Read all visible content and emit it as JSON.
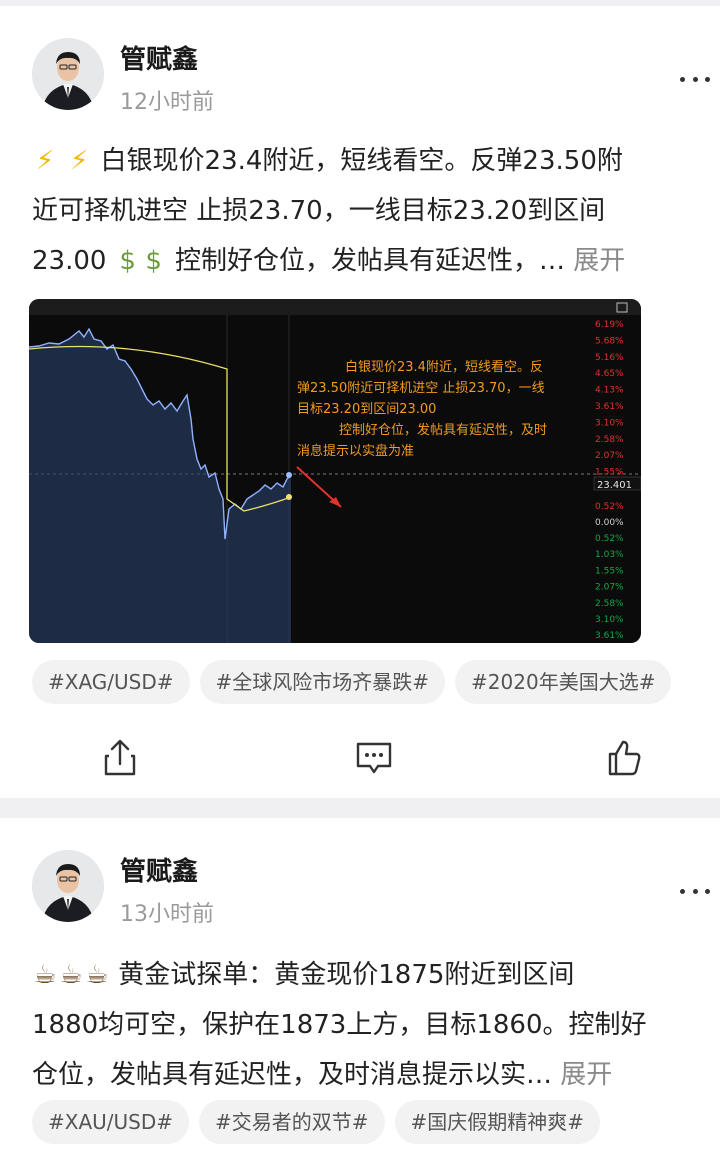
{
  "posts": [
    {
      "author": "管赋鑫",
      "time": "12小时前",
      "lines": [
        "白银现价23.4附近，短线看空。反弹23.50附",
        "近可择机进空 止损23.70，一线目标23.20到区间",
        "23.00",
        "控制好仓位，发帖具有延迟性，…"
      ],
      "expand_label": "展开",
      "lead_icons": [
        "lightning-icon",
        "lightning-icon"
      ],
      "mid_icons": [
        "money-bag-icon",
        "money-bag-icon"
      ],
      "tags": [
        "#XAG/USD#",
        "#全球风险市场齐暴跌#",
        "#2020年美国大选#"
      ],
      "chart": {
        "current_price": "23.401",
        "annotation": [
          "白银现价23.4附近，短线看空。反",
          "弹23.50附近可择机进空 止损23.70，一线",
          "目标23.20到区间23.00",
          "控制好仓位，发帖具有延迟性，及时",
          "消息提示以实盘为准"
        ],
        "right_axis_up": [
          "6.19%",
          "5.68%",
          "5.16%",
          "4.65%",
          "4.13%",
          "3.61%",
          "3.10%",
          "2.58%",
          "2.07%",
          "1.55%"
        ],
        "right_axis_mid": [
          "0.52%",
          "0.00%"
        ],
        "right_axis_down": [
          "0.52%",
          "1.03%",
          "1.55%",
          "2.07%",
          "2.58%",
          "3.10%",
          "3.61%"
        ]
      }
    },
    {
      "author": "管赋鑫",
      "time": "13小时前",
      "lines": [
        "黄金试探单：黄金现价1875附近到区间",
        "1880均可空，保护在1873上方，目标1860。控制好",
        "仓位，发帖具有延迟性，及时消息提示以实…"
      ],
      "expand_label": "展开",
      "lead_icons": [
        "coffee-icon",
        "coffee-icon",
        "coffee-icon"
      ],
      "tags": [
        "#XAU/USD#",
        "#交易者的双节#",
        "#国庆假期精神爽#"
      ]
    }
  ],
  "actions": [
    "share-icon",
    "comment-icon",
    "like-icon"
  ],
  "colors": {
    "accent_gold": "#f5b800",
    "up_red": "#e0332b",
    "down_green": "#1fa34a",
    "annotation_orange": "#f29b1f",
    "tag_bg": "#f2f2f2"
  }
}
